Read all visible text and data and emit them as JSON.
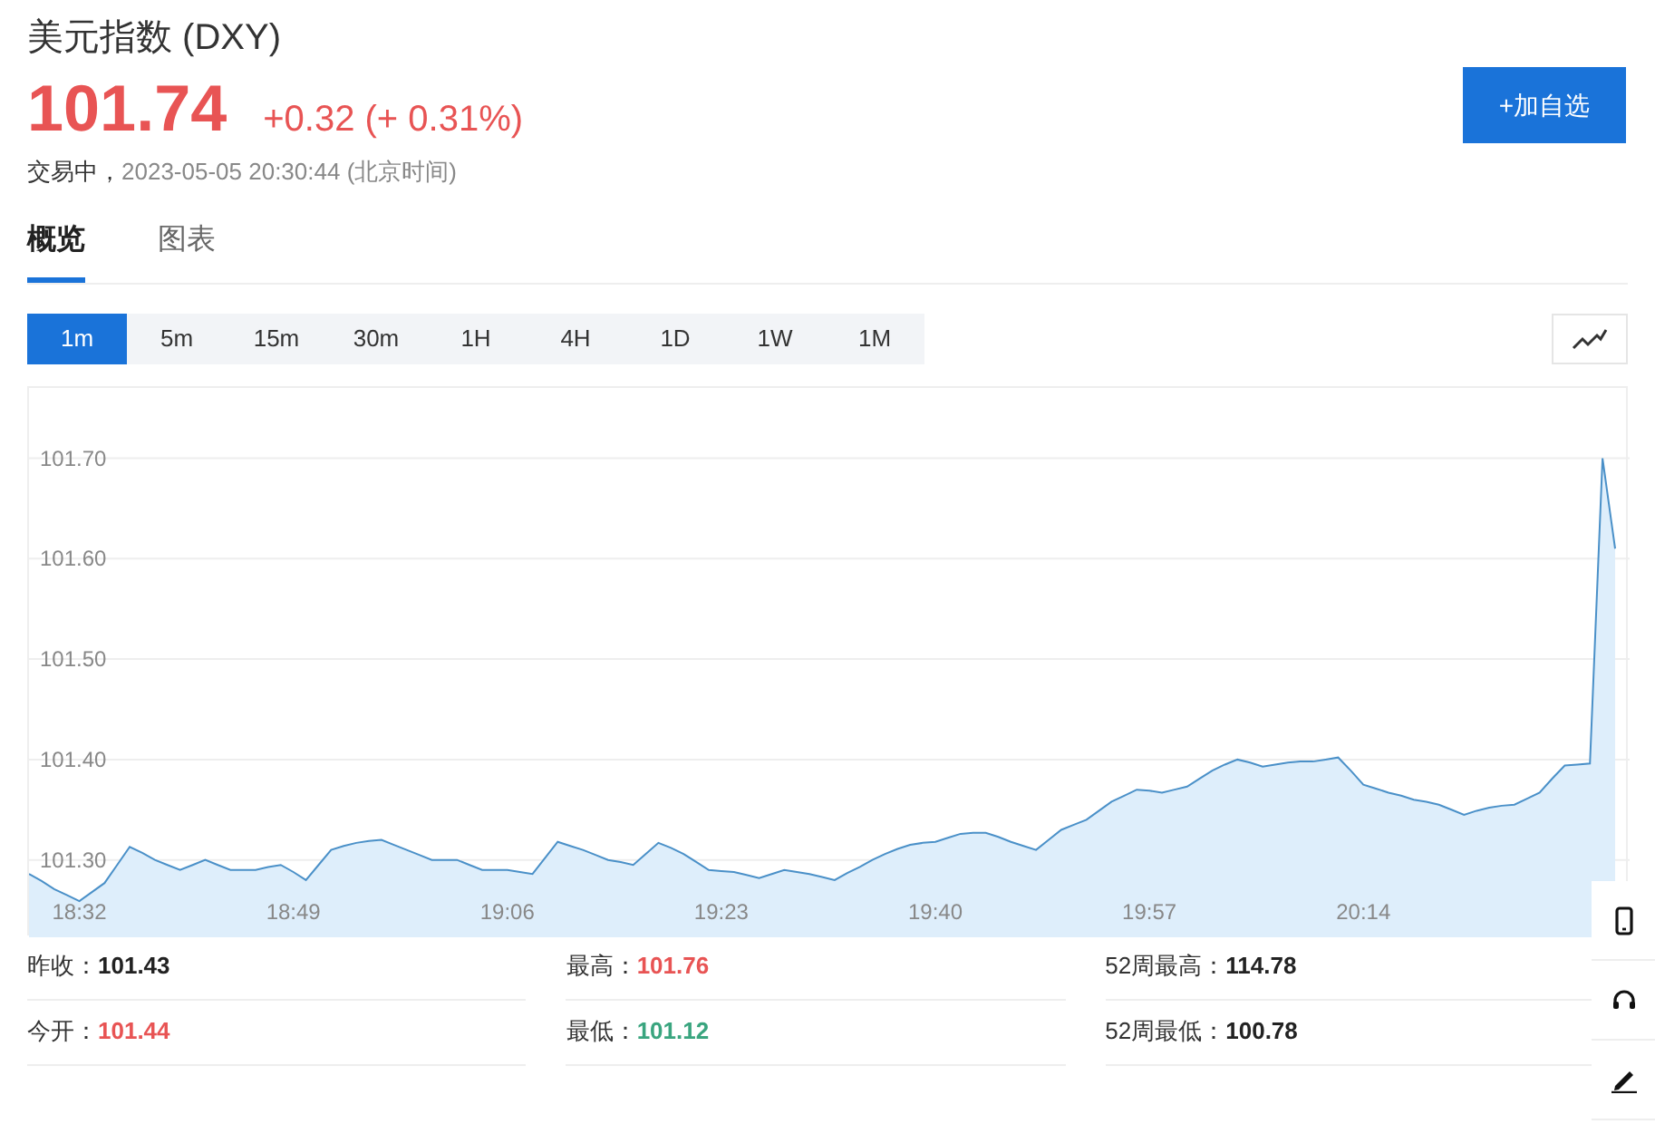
{
  "header": {
    "title": "美元指数 (DXY)",
    "price": "101.74",
    "change": "+0.32 (+ 0.31%)",
    "status": "交易中，",
    "time": "2023-05-05 20:30:44 (北京时间)",
    "add_button": "+加自选"
  },
  "tabs": [
    {
      "label": "概览",
      "selected": true
    },
    {
      "label": "图表",
      "selected": false
    }
  ],
  "periods": [
    {
      "label": "1m",
      "selected": true
    },
    {
      "label": "5m",
      "selected": false
    },
    {
      "label": "15m",
      "selected": false
    },
    {
      "label": "30m",
      "selected": false
    },
    {
      "label": "1H",
      "selected": false
    },
    {
      "label": "4H",
      "selected": false
    },
    {
      "label": "1D",
      "selected": false
    },
    {
      "label": "1W",
      "selected": false
    },
    {
      "label": "1M",
      "selected": false
    }
  ],
  "chart_data": {
    "type": "area",
    "categories": [
      null,
      null,
      null,
      null,
      "18:32",
      null,
      null,
      null,
      null,
      null,
      null,
      null,
      null,
      null,
      null,
      null,
      null,
      null,
      null,
      null,
      null,
      "18:49",
      null,
      null,
      null,
      null,
      null,
      null,
      null,
      null,
      null,
      null,
      null,
      null,
      null,
      null,
      null,
      null,
      "19:06",
      null,
      null,
      null,
      null,
      null,
      null,
      null,
      null,
      null,
      null,
      null,
      null,
      null,
      null,
      null,
      null,
      "19:23",
      null,
      null,
      null,
      null,
      null,
      null,
      null,
      null,
      null,
      null,
      null,
      null,
      null,
      null,
      null,
      null,
      "19:40",
      null,
      null,
      null,
      null,
      null,
      null,
      null,
      null,
      null,
      null,
      null,
      null,
      null,
      null,
      null,
      null,
      "19:57",
      null,
      null,
      null,
      null,
      null,
      null,
      null,
      null,
      null,
      null,
      null,
      null,
      null,
      null,
      null,
      null,
      "20:14",
      null,
      null,
      null,
      null,
      null,
      null,
      null,
      null,
      null,
      null,
      null,
      null,
      null,
      null,
      null,
      null,
      null,
      null,
      null,
      null
    ],
    "series": [
      {
        "color": "#4a90c8",
        "values": [
          101.286,
          101.279,
          101.271,
          101.265,
          101.259,
          101.268,
          101.277,
          101.295,
          101.313,
          101.307,
          101.3,
          101.295,
          101.29,
          101.295,
          101.3,
          101.295,
          101.29,
          101.29,
          101.29,
          101.293,
          101.295,
          101.288,
          101.28,
          101.295,
          101.31,
          101.314,
          101.317,
          101.319,
          101.32,
          101.315,
          101.31,
          101.305,
          101.3,
          101.3,
          101.3,
          101.295,
          101.29,
          101.29,
          101.29,
          101.288,
          101.286,
          101.302,
          101.318,
          101.314,
          101.31,
          101.305,
          101.3,
          101.298,
          101.295,
          101.306,
          101.317,
          101.312,
          101.306,
          101.298,
          101.29,
          101.289,
          101.288,
          101.285,
          101.282,
          101.286,
          101.29,
          101.288,
          101.286,
          101.283,
          101.28,
          101.287,
          101.293,
          101.3,
          101.306,
          101.311,
          101.315,
          101.317,
          101.318,
          101.322,
          101.326,
          101.327,
          101.327,
          101.323,
          101.318,
          101.314,
          101.31,
          101.32,
          101.33,
          101.335,
          101.34,
          101.349,
          101.358,
          101.364,
          101.37,
          101.369,
          101.367,
          101.37,
          101.373,
          101.381,
          101.389,
          101.395,
          101.4,
          101.397,
          101.393,
          101.395,
          101.397,
          101.398,
          101.398,
          101.4,
          101.402,
          101.389,
          101.375,
          101.371,
          101.367,
          101.364,
          101.36,
          101.358,
          101.355,
          101.35,
          101.345,
          101.349,
          101.352,
          101.354,
          101.355,
          101.361,
          101.367,
          101.381,
          101.394,
          101.395,
          101.396,
          101.7,
          101.61
        ]
      }
    ],
    "ylim": [
      101.223,
      101.77
    ],
    "grid": true,
    "yticks": [
      {
        "value": 101.3,
        "label": "101.30"
      },
      {
        "value": 101.4,
        "label": "101.40"
      },
      {
        "value": 101.5,
        "label": "101.50"
      },
      {
        "value": 101.6,
        "label": "101.60"
      },
      {
        "value": 101.7,
        "label": "101.70"
      }
    ]
  },
  "stats": [
    {
      "label": "昨收：",
      "value": "101.43",
      "color": "#222222"
    },
    {
      "label": "最高：",
      "value": "101.76",
      "color": "#e85454"
    },
    {
      "label": "52周最高：",
      "value": "114.78",
      "color": "#222222"
    },
    {
      "label": "今开：",
      "value": "101.44",
      "color": "#e85454"
    },
    {
      "label": "最低：",
      "value": "101.12",
      "color": "#3aa57f"
    },
    {
      "label": "52周最低：",
      "value": "100.78",
      "color": "#222222"
    }
  ]
}
